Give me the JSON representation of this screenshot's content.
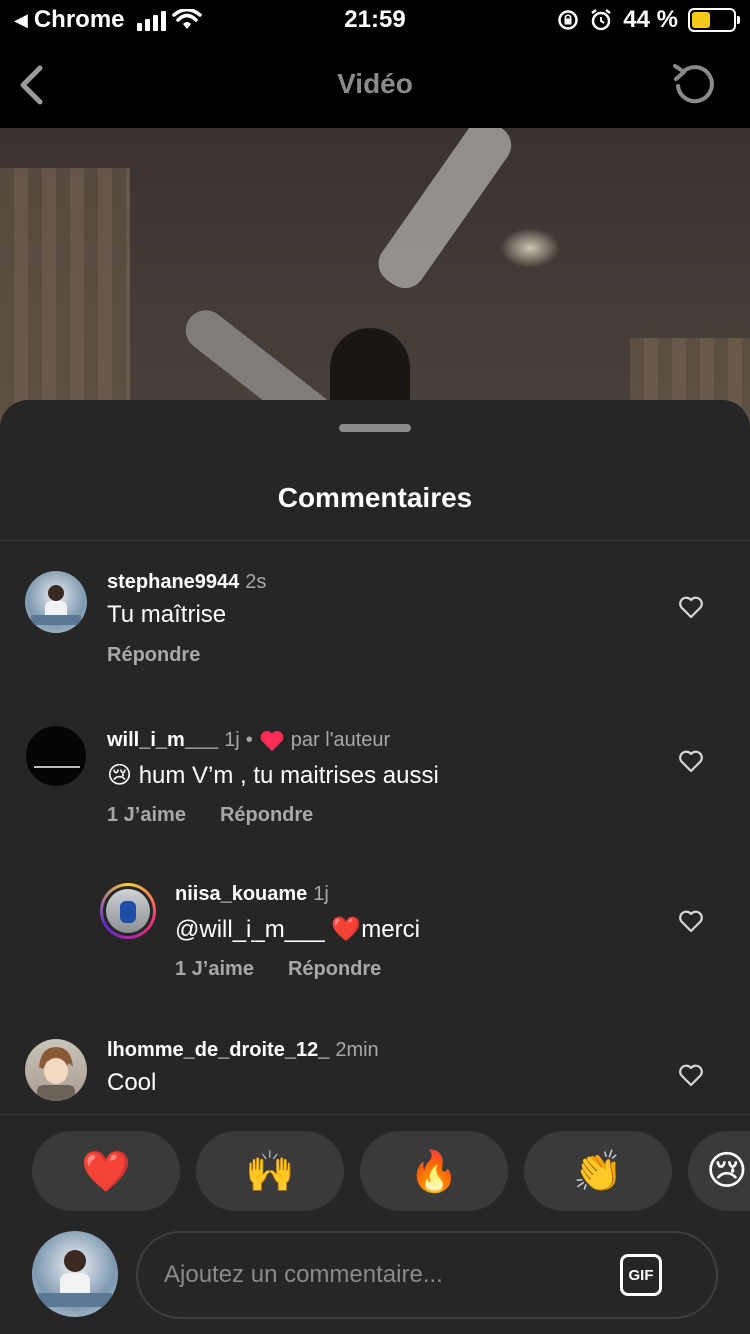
{
  "status_bar": {
    "back_app": "Chrome",
    "time": "21:59",
    "battery": "44 %",
    "battery_level": 0.44,
    "battery_color": "#f4c81d"
  },
  "nav": {
    "title": "Vidéo"
  },
  "sheet": {
    "title": "Commentaires"
  },
  "comments": [
    {
      "username": "stephane9944",
      "time": "2s",
      "meta": "",
      "text": "Tu maîtrise",
      "likes": "",
      "reply": "Répondre"
    },
    {
      "username": "will_i_m___",
      "time": "1j",
      "dot": "•",
      "meta": "par l'auteur",
      "text": "😢 hum V’m , tu maitrises aussi",
      "likes": "1 J’aime",
      "reply": "Répondre"
    },
    {
      "username": "niisa_kouame",
      "time": "1j",
      "meta": "",
      "text": "@will_i_m___ ❤️merci",
      "likes": "1 J’aime",
      "reply": "Répondre"
    },
    {
      "username": "lhomme_de_droite_12_",
      "time": "2min",
      "meta": "",
      "text": "Cool",
      "likes": "",
      "reply": ""
    }
  ],
  "composer": {
    "emojis": [
      "❤️",
      "🙌",
      "🔥",
      "👏",
      "😢"
    ],
    "placeholder": "Ajoutez un commentaire...",
    "gif_label": "GIF"
  },
  "colors": {
    "background": "#262626",
    "secondary_text": "#a8a8a8",
    "liked_heart": "#ff2d55"
  }
}
